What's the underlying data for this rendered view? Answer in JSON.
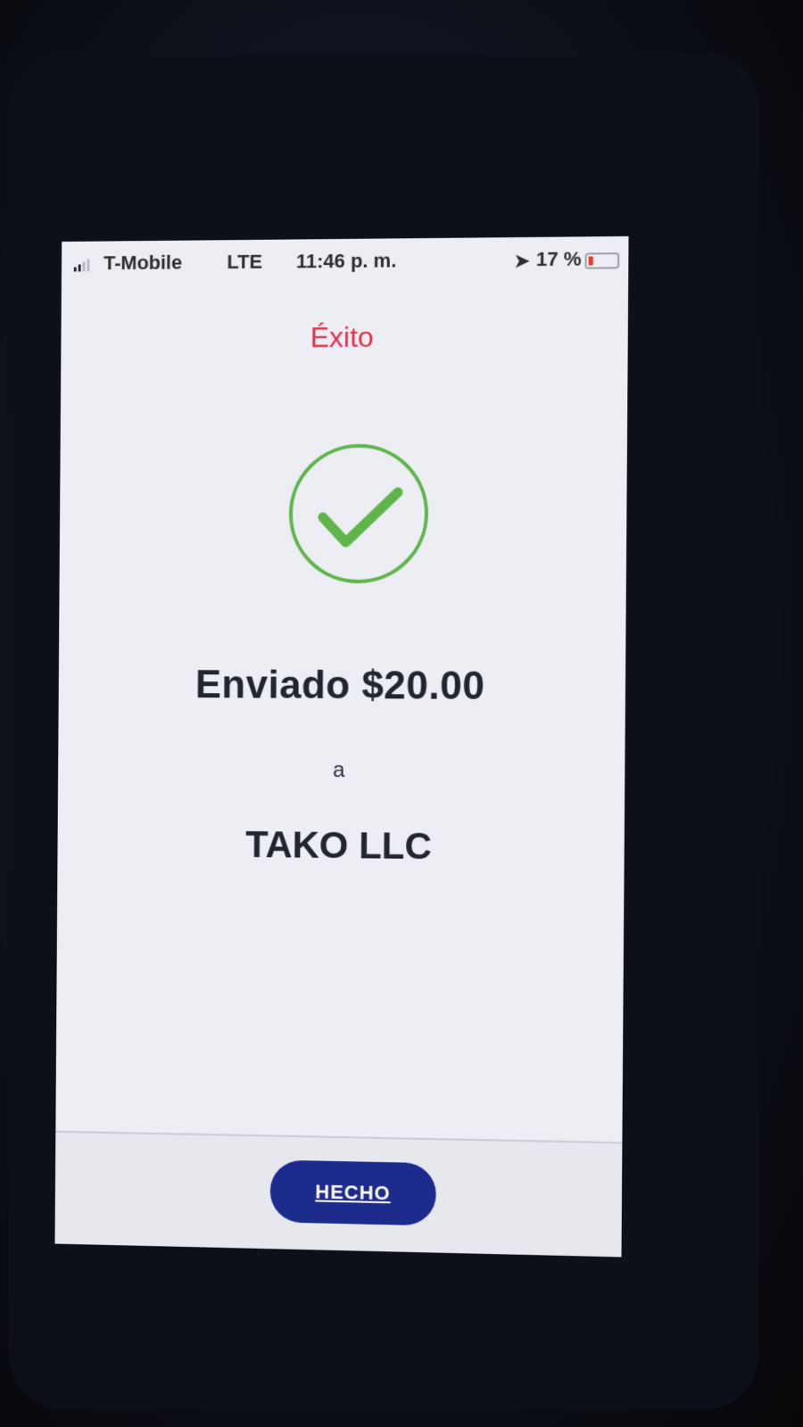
{
  "status_bar": {
    "carrier": "T-Mobile",
    "network": "LTE",
    "time": "11:46 p. m.",
    "battery_percent_label": "17 %",
    "battery_level": 0.17,
    "icons": [
      "signal-icon",
      "location-arrow-icon",
      "battery-icon"
    ]
  },
  "header": {
    "title": "Éxito"
  },
  "confirmation": {
    "icon": "checkmark-circle-icon",
    "sent_line": "Enviado $20.00",
    "connector": "a",
    "recipient": "TAKO LLC"
  },
  "footer": {
    "done_label": "HECHO"
  },
  "colors": {
    "title": "#e0334e",
    "check": "#5fb54a",
    "button": "#1c2b8c",
    "text": "#22252e"
  }
}
